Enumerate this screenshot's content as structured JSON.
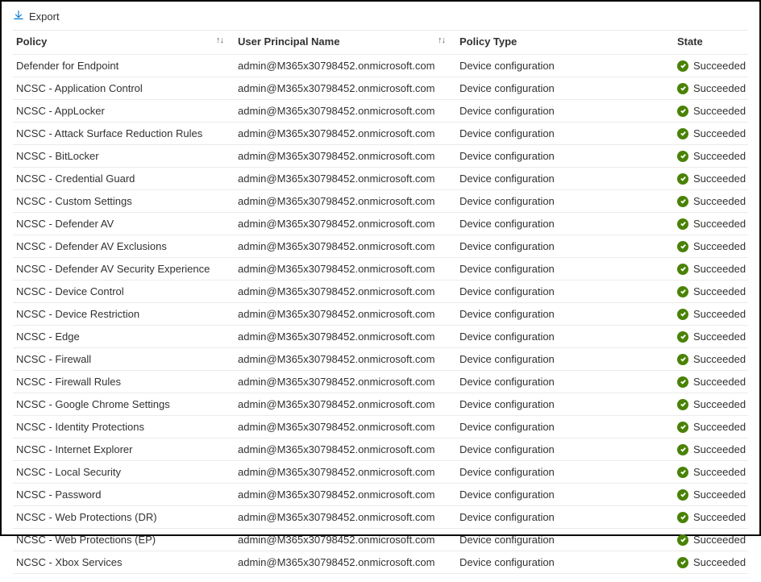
{
  "toolbar": {
    "export_label": "Export"
  },
  "columns": {
    "policy": "Policy",
    "upn": "User Principal Name",
    "type": "Policy Type",
    "state": "State"
  },
  "sort_glyph": "↑↓",
  "status": {
    "succeeded": "Succeeded"
  },
  "rows": [
    {
      "policy": "Defender for Endpoint",
      "upn": "admin@M365x30798452.onmicrosoft.com",
      "type": "Device configuration",
      "state": "Succeeded"
    },
    {
      "policy": "NCSC - Application Control",
      "upn": "admin@M365x30798452.onmicrosoft.com",
      "type": "Device configuration",
      "state": "Succeeded"
    },
    {
      "policy": "NCSC - AppLocker",
      "upn": "admin@M365x30798452.onmicrosoft.com",
      "type": "Device configuration",
      "state": "Succeeded"
    },
    {
      "policy": "NCSC - Attack Surface Reduction Rules",
      "upn": "admin@M365x30798452.onmicrosoft.com",
      "type": "Device configuration",
      "state": "Succeeded"
    },
    {
      "policy": "NCSC - BitLocker",
      "upn": "admin@M365x30798452.onmicrosoft.com",
      "type": "Device configuration",
      "state": "Succeeded"
    },
    {
      "policy": "NCSC - Credential Guard",
      "upn": "admin@M365x30798452.onmicrosoft.com",
      "type": "Device configuration",
      "state": "Succeeded"
    },
    {
      "policy": "NCSC - Custom Settings",
      "upn": "admin@M365x30798452.onmicrosoft.com",
      "type": "Device configuration",
      "state": "Succeeded"
    },
    {
      "policy": "NCSC - Defender AV",
      "upn": "admin@M365x30798452.onmicrosoft.com",
      "type": "Device configuration",
      "state": "Succeeded"
    },
    {
      "policy": "NCSC - Defender AV Exclusions",
      "upn": "admin@M365x30798452.onmicrosoft.com",
      "type": "Device configuration",
      "state": "Succeeded"
    },
    {
      "policy": "NCSC - Defender AV Security Experience",
      "upn": "admin@M365x30798452.onmicrosoft.com",
      "type": "Device configuration",
      "state": "Succeeded"
    },
    {
      "policy": "NCSC - Device Control",
      "upn": "admin@M365x30798452.onmicrosoft.com",
      "type": "Device configuration",
      "state": "Succeeded"
    },
    {
      "policy": "NCSC - Device Restriction",
      "upn": "admin@M365x30798452.onmicrosoft.com",
      "type": "Device configuration",
      "state": "Succeeded"
    },
    {
      "policy": "NCSC - Edge",
      "upn": "admin@M365x30798452.onmicrosoft.com",
      "type": "Device configuration",
      "state": "Succeeded"
    },
    {
      "policy": "NCSC - Firewall",
      "upn": "admin@M365x30798452.onmicrosoft.com",
      "type": "Device configuration",
      "state": "Succeeded"
    },
    {
      "policy": "NCSC - Firewall Rules",
      "upn": "admin@M365x30798452.onmicrosoft.com",
      "type": "Device configuration",
      "state": "Succeeded"
    },
    {
      "policy": "NCSC - Google Chrome Settings",
      "upn": "admin@M365x30798452.onmicrosoft.com",
      "type": "Device configuration",
      "state": "Succeeded"
    },
    {
      "policy": "NCSC - Identity Protections",
      "upn": "admin@M365x30798452.onmicrosoft.com",
      "type": "Device configuration",
      "state": "Succeeded"
    },
    {
      "policy": "NCSC - Internet Explorer",
      "upn": "admin@M365x30798452.onmicrosoft.com",
      "type": "Device configuration",
      "state": "Succeeded"
    },
    {
      "policy": "NCSC - Local Security",
      "upn": "admin@M365x30798452.onmicrosoft.com",
      "type": "Device configuration",
      "state": "Succeeded"
    },
    {
      "policy": "NCSC - Password",
      "upn": "admin@M365x30798452.onmicrosoft.com",
      "type": "Device configuration",
      "state": "Succeeded"
    },
    {
      "policy": "NCSC - Web Protections (DR)",
      "upn": "admin@M365x30798452.onmicrosoft.com",
      "type": "Device configuration",
      "state": "Succeeded"
    },
    {
      "policy": "NCSC - Web Protections (EP)",
      "upn": "admin@M365x30798452.onmicrosoft.com",
      "type": "Device configuration",
      "state": "Succeeded"
    },
    {
      "policy": "NCSC - Xbox Services",
      "upn": "admin@M365x30798452.onmicrosoft.com",
      "type": "Device configuration",
      "state": "Succeeded"
    }
  ]
}
